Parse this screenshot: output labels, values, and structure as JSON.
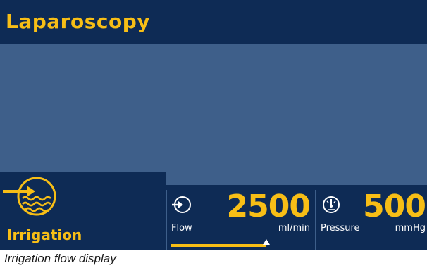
{
  "header": {
    "title": "Laparoscopy"
  },
  "mode": {
    "label": "Irrigation",
    "icon": "irrigation-icon"
  },
  "flow": {
    "label": "Flow",
    "value": "2500",
    "unit": "ml/min",
    "icon": "flow-icon",
    "level_fraction": 0.68
  },
  "pressure": {
    "label": "Pressure",
    "value": "500",
    "unit": "mmHg",
    "icon": "pressure-gauge-icon"
  },
  "caption": "Irrigation flow display",
  "colors": {
    "header_bg": "#0e2b55",
    "screen_bg": "#3e5f8a",
    "accent": "#f7be16",
    "text": "#ffffff"
  }
}
